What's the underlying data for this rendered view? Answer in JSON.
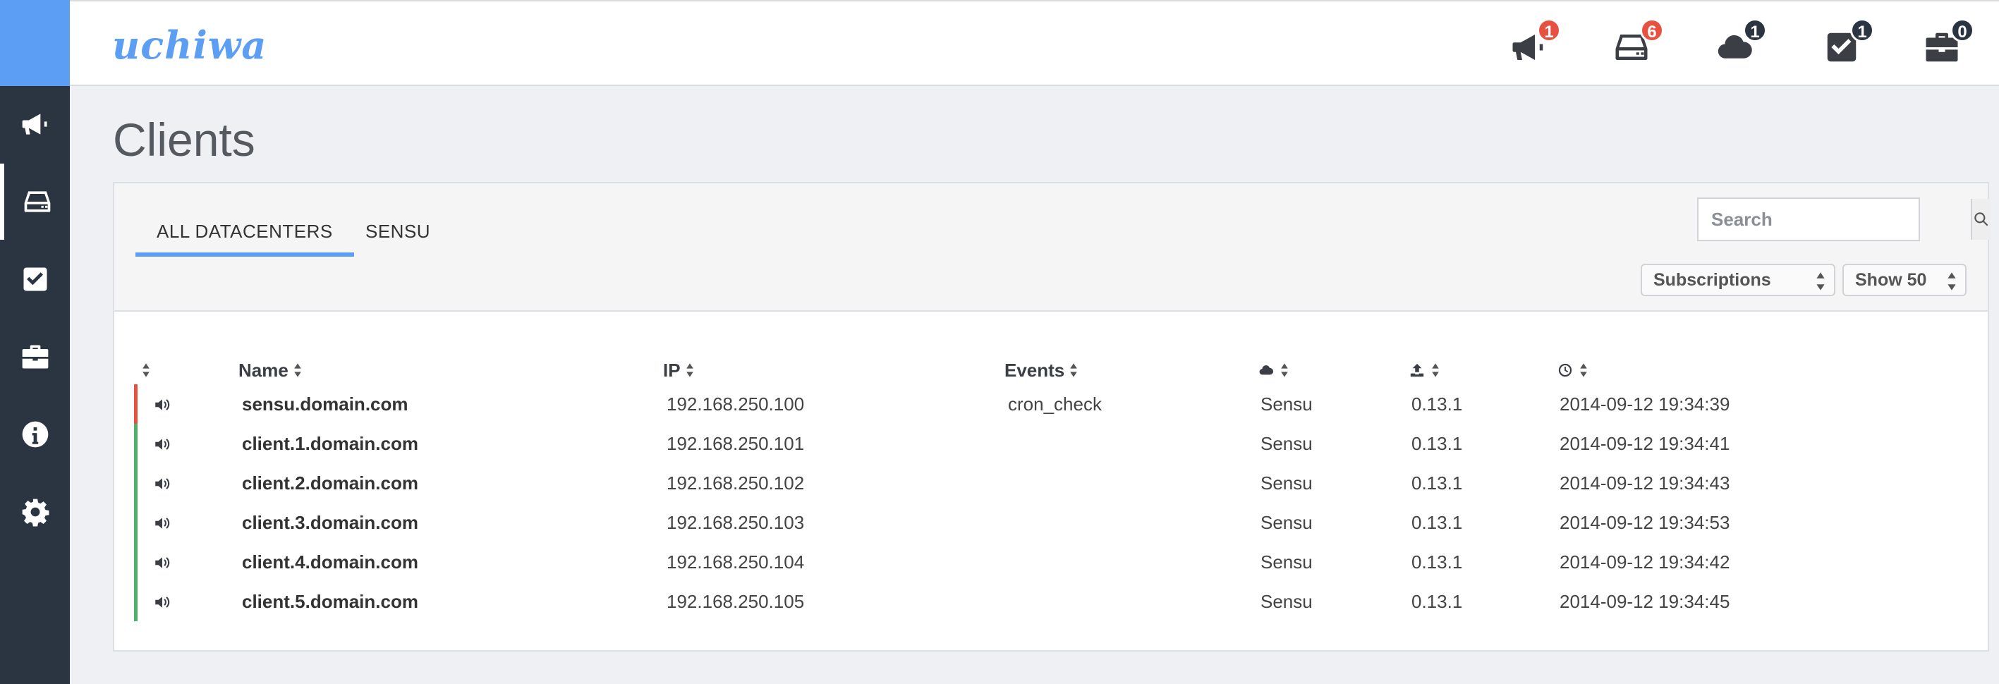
{
  "app": {
    "logo": "uchiwa"
  },
  "nav": {
    "items": [
      {
        "icon": "megaphone-icon",
        "badge": "1",
        "badge_color": "#e8503f"
      },
      {
        "icon": "server-drive-icon",
        "badge": "6",
        "badge_color": "#e8503f"
      },
      {
        "icon": "cloud-icon",
        "badge": "1",
        "badge_color": "#2b3542"
      },
      {
        "icon": "checkbox-icon",
        "badge": "1",
        "badge_color": "#2b3542"
      },
      {
        "icon": "briefcase-icon",
        "badge": "0",
        "badge_color": "#2b3542"
      }
    ]
  },
  "sidebar": {
    "items": [
      {
        "icon": "megaphone-icon",
        "active": false
      },
      {
        "icon": "server-drive-icon",
        "active": true
      },
      {
        "icon": "checkbox-icon",
        "active": false
      },
      {
        "icon": "briefcase-icon",
        "active": false
      },
      {
        "icon": "info-icon",
        "active": false
      },
      {
        "icon": "gear-icon",
        "active": false
      }
    ]
  },
  "page": {
    "title": "Clients"
  },
  "tabs": [
    {
      "label": "ALL DATACENTERS",
      "active": true
    },
    {
      "label": "SENSU",
      "active": false
    }
  ],
  "search": {
    "placeholder": "Search"
  },
  "filters": {
    "subscriptions": "Subscriptions",
    "show": "Show 50"
  },
  "table": {
    "headers": {
      "name": "Name",
      "ip": "IP",
      "events": "Events",
      "datacenter_icon": "cloud-icon",
      "version_icon": "upload-icon",
      "timestamp_icon": "clock-icon"
    },
    "rows": [
      {
        "status": "critical",
        "name": "sensu.domain.com",
        "ip": "192.168.250.100",
        "events": "cron_check",
        "datacenter": "Sensu",
        "version": "0.13.1",
        "timestamp": "2014-09-12 19:34:39"
      },
      {
        "status": "ok",
        "name": "client.1.domain.com",
        "ip": "192.168.250.101",
        "events": "",
        "datacenter": "Sensu",
        "version": "0.13.1",
        "timestamp": "2014-09-12 19:34:41"
      },
      {
        "status": "ok",
        "name": "client.2.domain.com",
        "ip": "192.168.250.102",
        "events": "",
        "datacenter": "Sensu",
        "version": "0.13.1",
        "timestamp": "2014-09-12 19:34:43"
      },
      {
        "status": "ok",
        "name": "client.3.domain.com",
        "ip": "192.168.250.103",
        "events": "",
        "datacenter": "Sensu",
        "version": "0.13.1",
        "timestamp": "2014-09-12 19:34:53"
      },
      {
        "status": "ok",
        "name": "client.4.domain.com",
        "ip": "192.168.250.104",
        "events": "",
        "datacenter": "Sensu",
        "version": "0.13.1",
        "timestamp": "2014-09-12 19:34:42"
      },
      {
        "status": "ok",
        "name": "client.5.domain.com",
        "ip": "192.168.250.105",
        "events": "",
        "datacenter": "Sensu",
        "version": "0.13.1",
        "timestamp": "2014-09-12 19:34:45"
      }
    ]
  },
  "colors": {
    "accent": "#5b9ef3",
    "sidebar": "#2b3542",
    "critical": "#e8503f",
    "ok": "#4caf6a"
  }
}
